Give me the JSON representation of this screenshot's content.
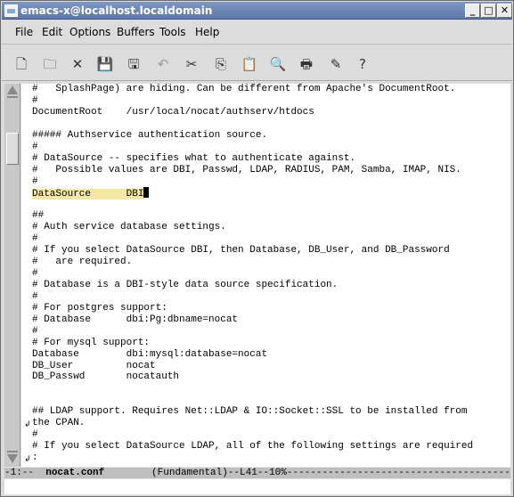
{
  "window": {
    "title": "emacs-x@localhost.localdomain",
    "controls": [
      "_",
      "□",
      "✕"
    ]
  },
  "menubar": {
    "items": [
      "File",
      "Edit",
      "Options",
      "Buffers",
      "Tools",
      "Help"
    ]
  },
  "toolbar": {
    "tools": [
      {
        "name": "new-file-icon",
        "glyph": "🗋"
      },
      {
        "name": "open-folder-icon",
        "glyph": "🗀"
      },
      {
        "name": "close-icon",
        "glyph": "✕"
      },
      {
        "name": "save-icon",
        "glyph": "💾"
      },
      {
        "name": "save-as-icon",
        "glyph": "🖫"
      },
      {
        "name": "undo-icon",
        "glyph": "↶"
      },
      {
        "name": "cut-icon",
        "glyph": "✂"
      },
      {
        "name": "copy-icon",
        "glyph": "⎘"
      },
      {
        "name": "paste-icon",
        "glyph": "📋"
      },
      {
        "name": "search-icon",
        "glyph": "🔍"
      },
      {
        "name": "print-icon",
        "glyph": "🖶"
      },
      {
        "name": "customize-icon",
        "glyph": "✎"
      },
      {
        "name": "help-icon",
        "glyph": "?"
      }
    ]
  },
  "buffer": {
    "lines": [
      "#   SplashPage) are hiding. Can be different from Apache's DocumentRoot.",
      "#",
      "DocumentRoot    /usr/local/nocat/authserv/htdocs",
      "",
      "##### Authservice authentication source.",
      "#",
      "# DataSource -- specifies what to authenticate against.",
      "#   Possible values are DBI, Passwd, LDAP, RADIUS, PAM, Samba, IMAP, NIS.",
      "#",
      "DataSource      DBI",
      "",
      "##",
      "# Auth service database settings.",
      "#",
      "# If you select DataSource DBI, then Database, DB_User, and DB_Password",
      "#   are required.",
      "#",
      "# Database is a DBI-style data source specification.",
      "#",
      "# For postgres support:",
      "# Database      dbi:Pg:dbname=nocat",
      "#",
      "# For mysql support:",
      "Database        dbi:mysql:database=nocat",
      "DB_User         nocat",
      "DB_Passwd       nocatauth",
      "",
      "",
      "## LDAP support. Requires Net::LDAP & IO::Socket::SSL to be installed from",
      "the CPAN.",
      "#",
      "# If you select DataSource LDAP, all of the following settings are required",
      ":"
    ],
    "highlight_line": 9,
    "wrap_markers": [
      "↲",
      "↲"
    ]
  },
  "modeline": {
    "prefix": "-1:--  ",
    "buffer_name": "nocat.conf",
    "rest": "        (Fundamental)--L41--10%------------------------------------------"
  }
}
